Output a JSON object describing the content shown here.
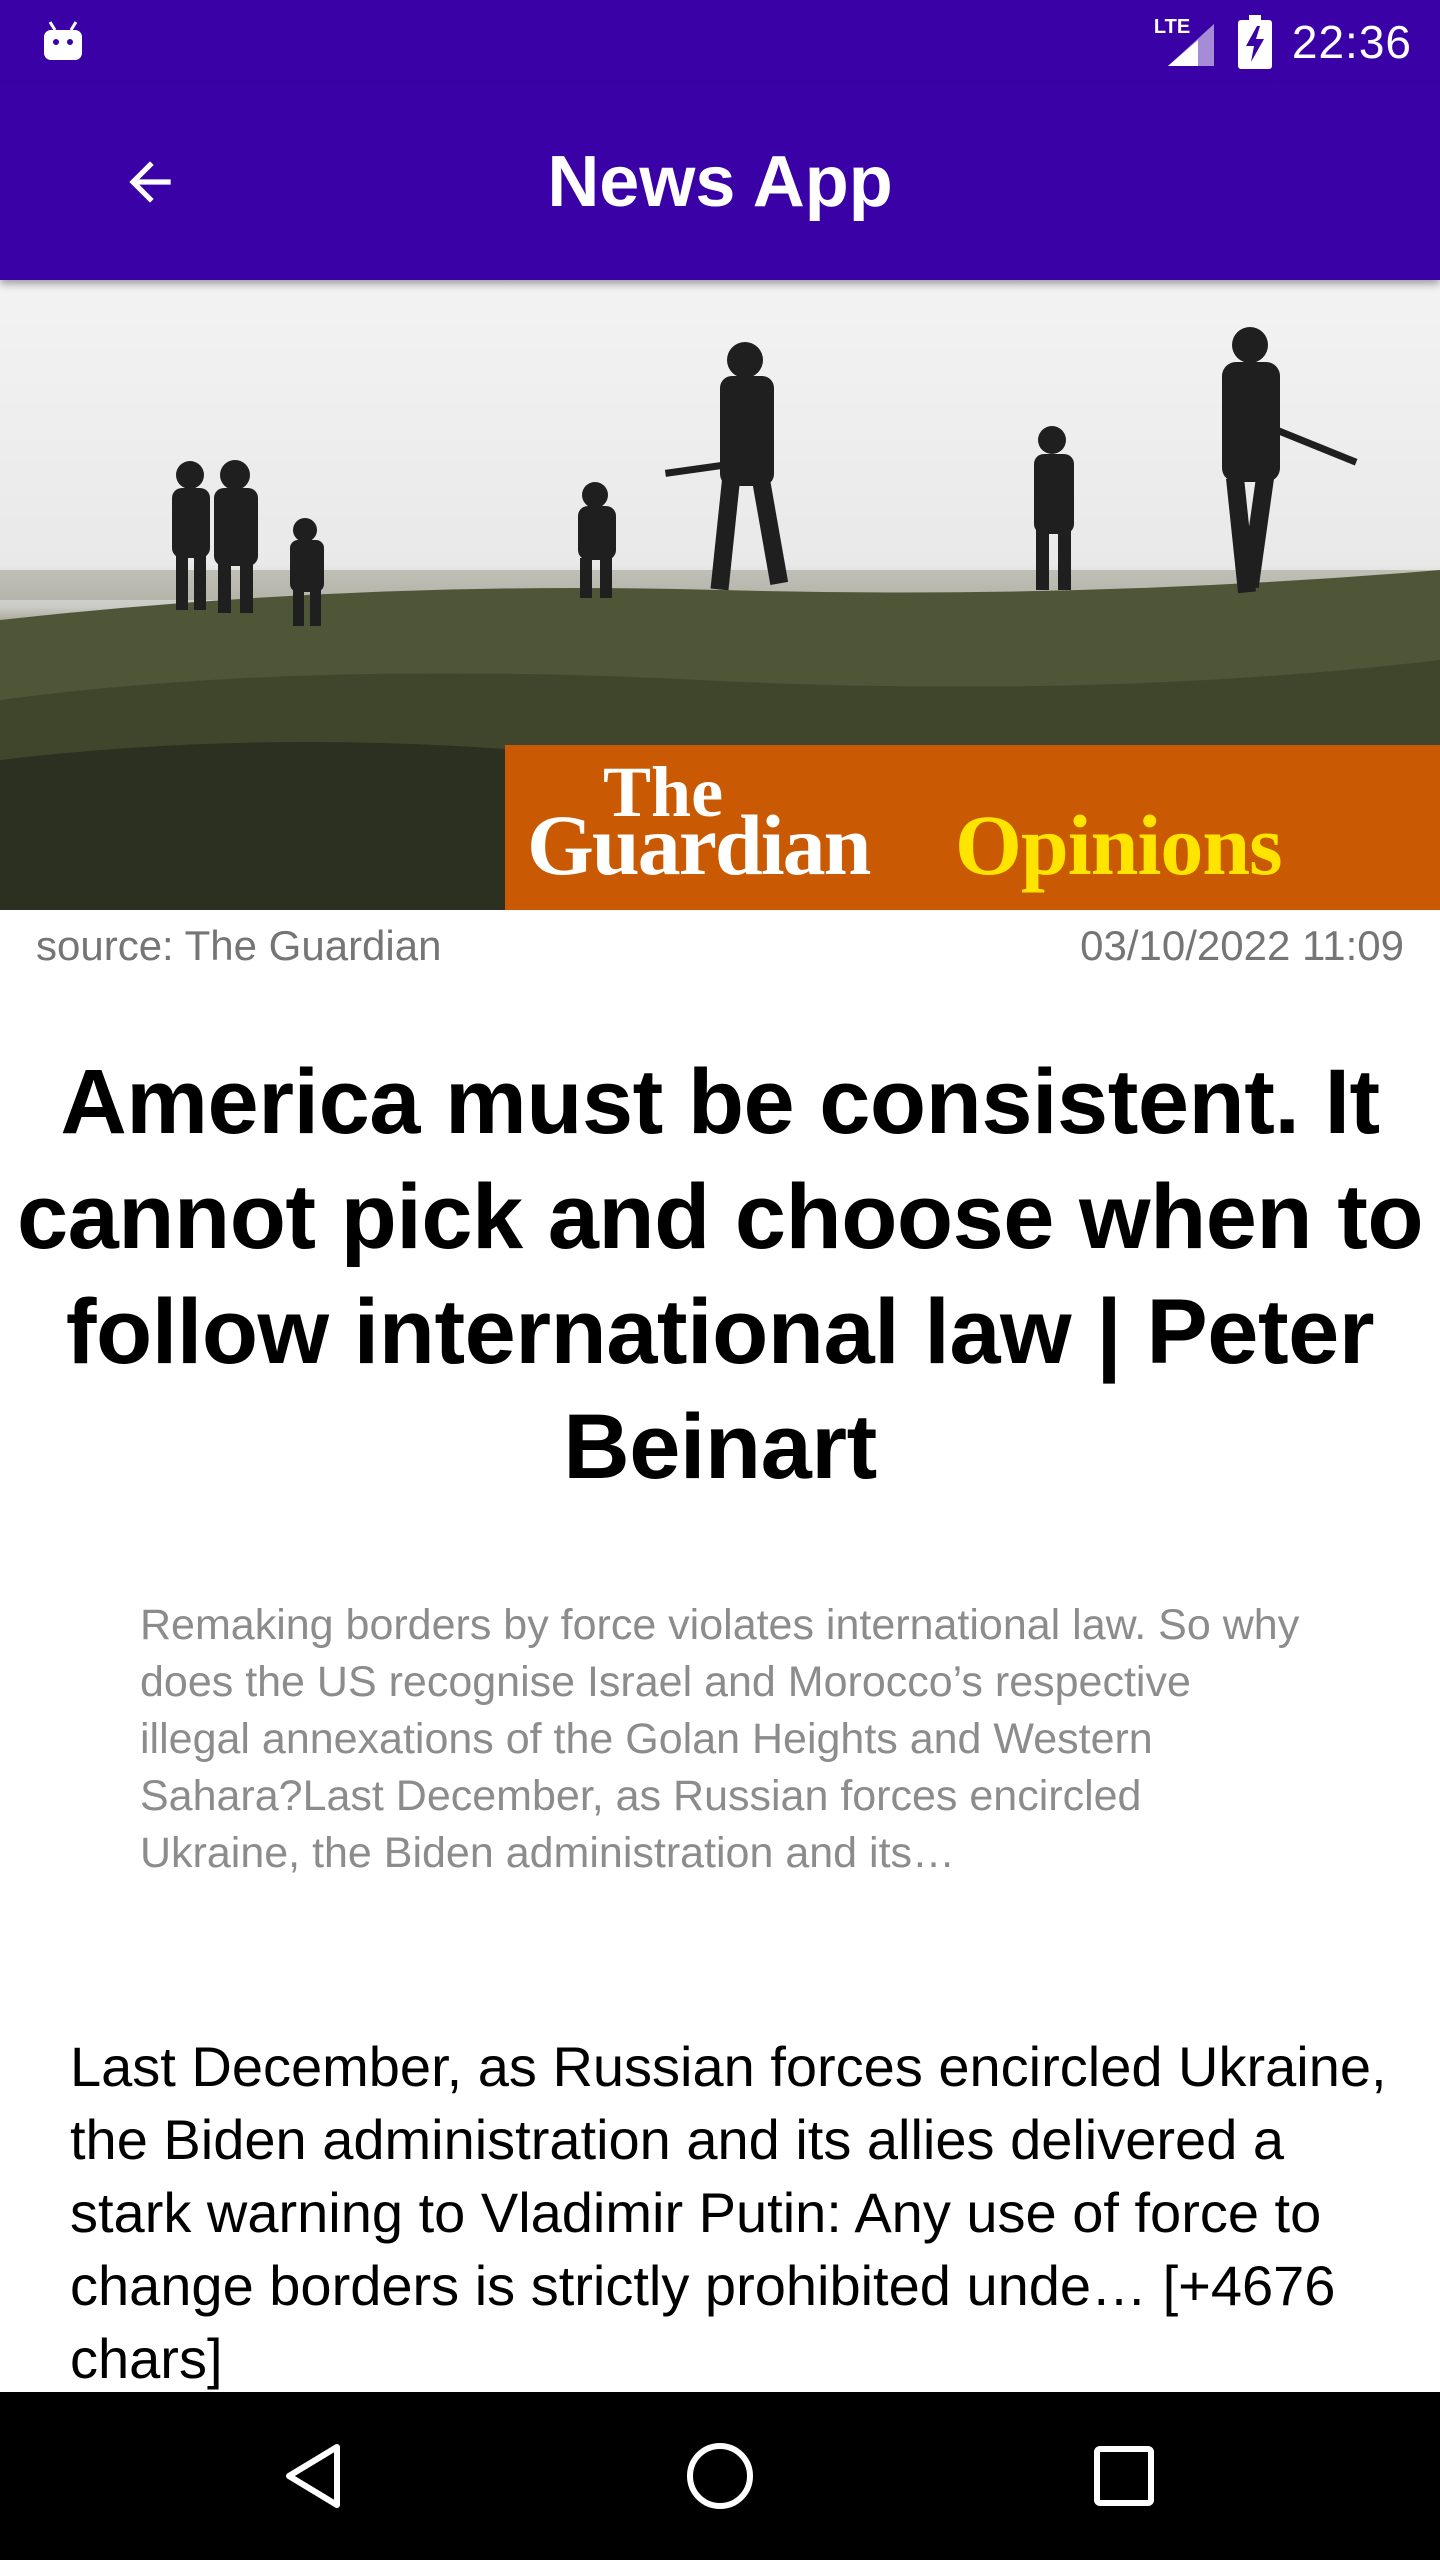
{
  "status_bar": {
    "network_label": "LTE",
    "time": "22:36"
  },
  "app_bar": {
    "title": "News App",
    "back_icon": "arrow-back-icon"
  },
  "article": {
    "hero_banner": {
      "the": "The",
      "guardian": "Guardian",
      "opinions": "Opinions"
    },
    "source": "source: The Guardian",
    "published": "03/10/2022 11:09",
    "title": "America must be consistent. It cannot pick and choose when to follow international law | Peter Beinart",
    "description": "Remaking borders by force violates international law. So why does the US recognise Israel and Morocco’s respective illegal annexations of the Golan Heights and Western Sahara?Last December, as Russian forces encircled Ukraine, the Biden administration and its…",
    "content": "Last December, as Russian forces encircled Ukraine, the Biden administration and its allies delivered a stark warning to Vladimir Putin: Any use of force to change borders is strictly prohibited unde… [+4676 chars]"
  },
  "nav_bar": {
    "back_icon": "nav-back-icon",
    "home_icon": "nav-home-icon",
    "recents_icon": "nav-recents-icon"
  },
  "colors": {
    "primary": "#3A02A6",
    "banner_orange": "#C95A03",
    "banner_yellow": "#FFE400",
    "meta_gray": "#757575"
  }
}
